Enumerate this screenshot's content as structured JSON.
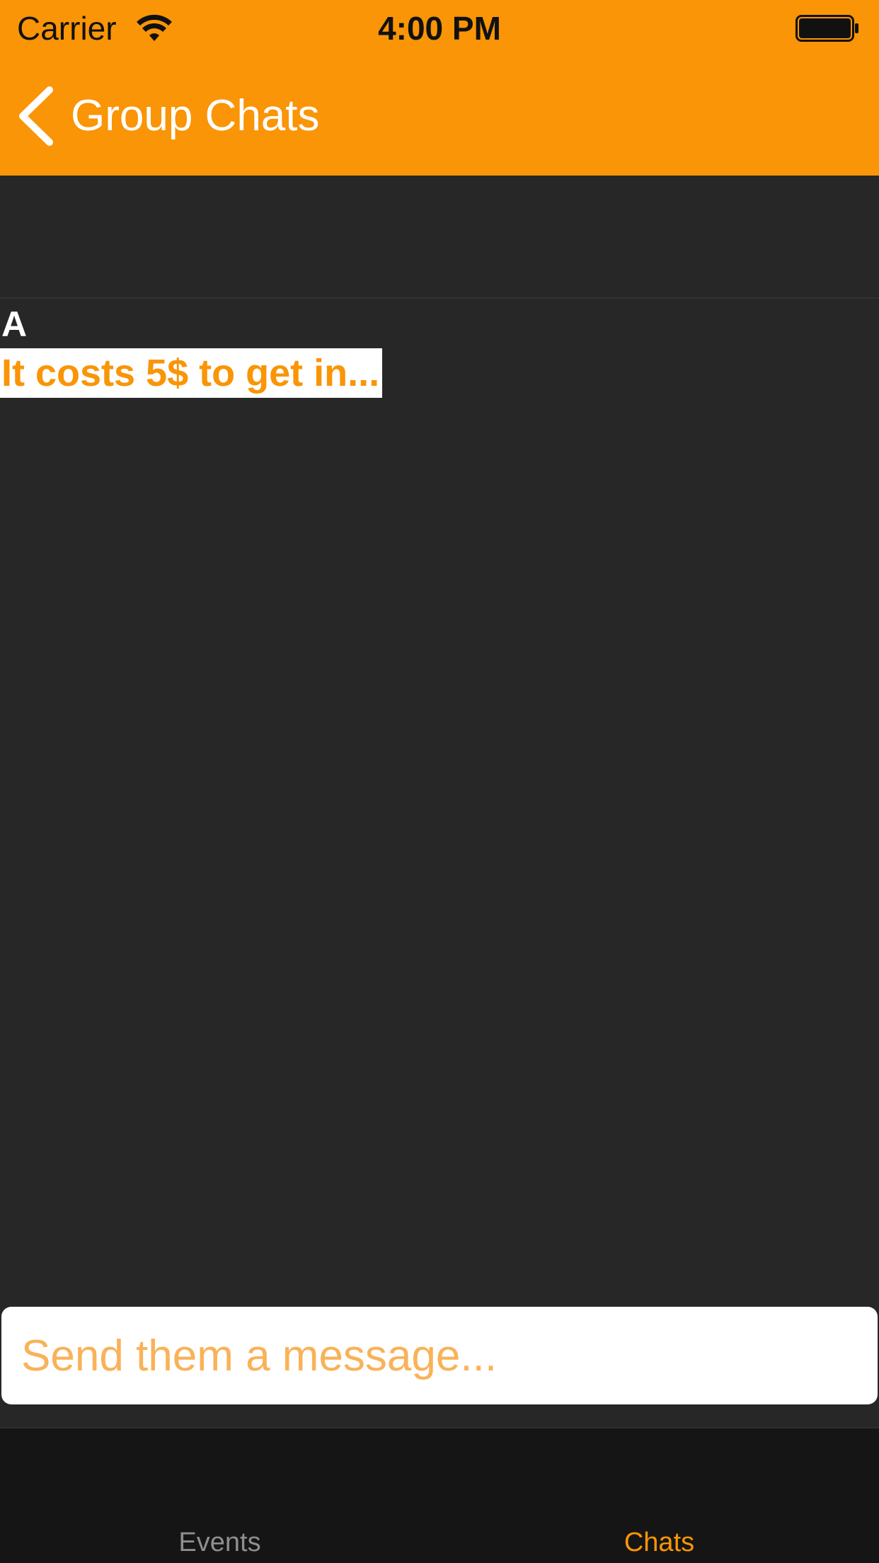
{
  "status_bar": {
    "carrier": "Carrier",
    "time": "4:00 PM",
    "wifi_icon": "wifi-icon",
    "battery_icon": "battery-icon"
  },
  "nav": {
    "back_icon": "chevron-left-icon",
    "back_label": "Group Chats"
  },
  "messages": [
    {
      "sender": "A",
      "text": "It costs 5$ to get in..."
    }
  ],
  "composer": {
    "placeholder": "Send them a message...",
    "value": ""
  },
  "tab_bar": {
    "tabs": [
      {
        "label": "Events",
        "selected": false
      },
      {
        "label": "Chats",
        "selected": true
      }
    ]
  },
  "colors": {
    "accent": "#f99506",
    "background": "#272727",
    "tab_bar": "#151515",
    "bubble": "#ffffff",
    "inactive_tab": "#8e8e8e"
  }
}
